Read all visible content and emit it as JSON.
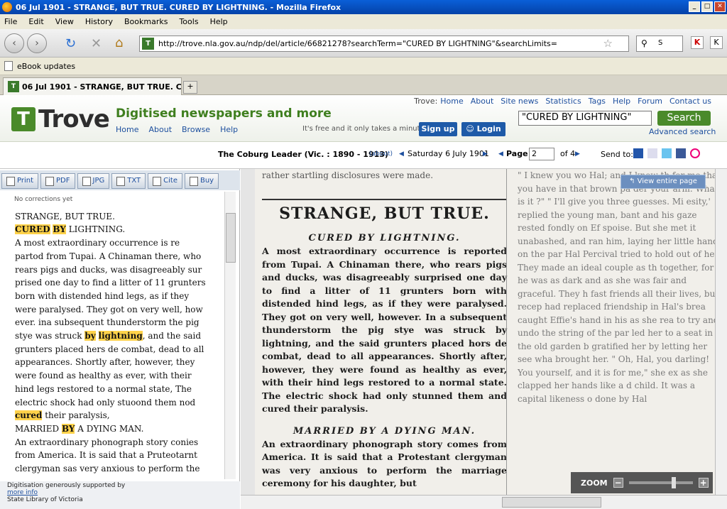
{
  "window": {
    "title": "06 Jul 1901 - STRANGE, BUT TRUE. CURED BY LIGHTNING. - Mozilla Firefox"
  },
  "menu": [
    "File",
    "Edit",
    "View",
    "History",
    "Bookmarks",
    "Tools",
    "Help"
  ],
  "url": "http://trove.nla.gov.au/ndp/del/article/66821278?searchTerm=\"CURED BY LIGHTNING\"&searchLimits=",
  "browser_search": "S",
  "bookmark": "eBook updates",
  "tab": "06 Jul 1901 - STRANGE, BUT TRUE. CU...",
  "header": {
    "logo": "Trove",
    "tagline": "Digitised newspapers and more",
    "sublinks": [
      "Home",
      "About",
      "Browse",
      "Help"
    ],
    "toplabel": "Trove:",
    "toplinks": [
      "Home",
      "About",
      "Site news",
      "Statistics",
      "Tags",
      "Help",
      "Forum",
      "Contact us"
    ],
    "free_text": "It's free and it only takes a minute",
    "signup": "Sign up",
    "login": "Login",
    "search_value": "\"CURED BY LIGHTNING\"",
    "search_btn": "Search",
    "advanced": "Advanced search"
  },
  "info": {
    "publication": "The Coburg Leader (Vic. : 1890 - 1913)",
    "about": "(about)",
    "date": "Saturday 6 July 1901",
    "page_label": "Page",
    "page_value": "2",
    "page_of": "of 4",
    "send_to": "Send to:"
  },
  "tools": [
    "Print",
    "PDF",
    "JPG",
    "TXT",
    "Cite",
    "Buy"
  ],
  "text": {
    "no_corrections": "No corrections yet",
    "lines": [
      "STRANGE, BUT TRUE.",
      "A most extraordinary occurrence is re",
      "partod from Tupai. A Chinaman there, who",
      "rears pigs and ducks, was disagreeably sur",
      "prised one day to find a litter of 11 grunters",
      "born with distended hind legs, as if they",
      "were paralysed. They got on very well, how",
      "ever. ina subsequent thunderstorm the pig",
      "grunters placed hers de combat, dead to all",
      "appearances. Shortly after, however, they",
      "were found as healthy as ever, with their",
      "hind legs restored to a normal state, The",
      "electric shock had only stuoond them nod",
      "An extraordinary phonograph story conies",
      "from America. It is said that a Pruteotarnt",
      "clergyman sas very anxious to perform the"
    ],
    "h_cured": "CURED",
    "h_by": "BY",
    "h_lightning_rest": " LIGHTNING.",
    "stye_pre": "stye was struck ",
    "h_by2": "by",
    "h_lightning2": "lightning",
    "stye_post": ", and the said",
    "h_cured2": "cured",
    "cured_post": " their paralysis,",
    "married_pre": "MARRIED ",
    "h_by3": "BY",
    "married_post": " A DYING MAN."
  },
  "credit": {
    "line1": "Digitisation generously supported by",
    "more": "more info",
    "line2": "State Library of Victoria"
  },
  "scan": {
    "top": "rather startling disclosures were made.",
    "headline": "STRANGE, BUT TRUE.",
    "sub1": "CURED BY LIGHTNING.",
    "para1": "A most extraordinary occurrence is reported from Tupai. A Chinaman there, who rears pigs and ducks, was disagreeably surprised one day to find a litter of 11 grunters born with distended hind legs, as if they were paralysed. They got on very well, however. In a subsequent thunderstorm the pig stye was struck by lightning, and the said grunters placed hors de combat, dead to all appearances. Shortly after, however, they were found as healthy as ever, with their hind legs restored to a normal state. The electric shock had only stunned them and cured their paralysis.",
    "sub2": "MARRIED BY A DYING MAN.",
    "para2": "An extraordinary phonograph story comes from America. It is said that a Protestant clergyman was very anxious to perform the marriage ceremony for his daughter, but",
    "col2": "\" I knew you wo Hal; and I know th for me that you have in that brown pa der your arm. What is it ?\" \" I'll give you three guesses. Mi esity,' replied the young man, bant and his gaze rested fondly on Ef spoise. But she met it unabashed, and ran him, laying her little hand on the par Hal Percival tried to hold out of her They made an ideal couple as th together, for he was as dark and as she was fair and graceful. They h fast friends all their lives, but recep had replaced friendship in Hal's brea caught Effie's hand in his as she rea to try and undo the string of the par led her to a seat in the old garden b gratified her by letting her see wha brought her. \" Oh, Hal, you darling! You yourself, and it is for me,\" she ex as she clapped her hands like a d child. It was a capital likeness o done by Hal"
  },
  "view_entire": "View entire page",
  "zoom": "ZOOM"
}
